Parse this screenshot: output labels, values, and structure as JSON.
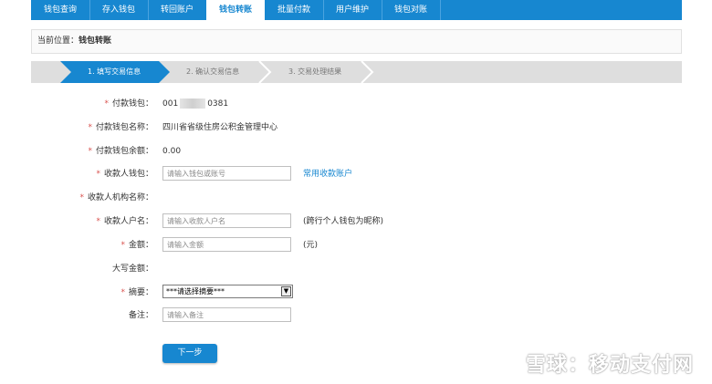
{
  "nav": {
    "tabs": [
      {
        "label": "钱包查询"
      },
      {
        "label": "存入钱包"
      },
      {
        "label": "转回账户"
      },
      {
        "label": "钱包转账"
      },
      {
        "label": "批量付款"
      },
      {
        "label": "用户维护"
      },
      {
        "label": "钱包对账"
      }
    ],
    "active_index": 3
  },
  "location": {
    "label": "当前位置：",
    "current": "钱包转账"
  },
  "steps": [
    {
      "label": "1. 填写交易信息"
    },
    {
      "label": "2. 确认交易信息"
    },
    {
      "label": "3. 交易处理结果"
    }
  ],
  "form": {
    "payer_wallet": {
      "label": "付款钱包：",
      "value_prefix": "001",
      "value_suffix": "0381"
    },
    "payer_wallet_name": {
      "label": "付款钱包名称：",
      "value": "四川省省级住房公积金管理中心"
    },
    "payer_wallet_balance": {
      "label": "付款钱包余额：",
      "value": "0.00"
    },
    "payee_wallet": {
      "label": "收款人钱包：",
      "placeholder": "请输入钱包或账号",
      "link": "常用收款账户"
    },
    "payee_org_name": {
      "label": "收款人机构名称："
    },
    "payee_account_name": {
      "label": "收款人户名：",
      "placeholder": "请输入收款人户名",
      "note": "(跨行个人钱包为昵称)"
    },
    "amount": {
      "label": "金额：",
      "placeholder": "请输入金额",
      "note": "(元)"
    },
    "amount_upper": {
      "label": "大写金额："
    },
    "summary": {
      "label": "摘要：",
      "selected": "***请选择摘要***"
    },
    "remark": {
      "label": "备注：",
      "placeholder": "请输入备注"
    }
  },
  "next_button": "下一步",
  "watermark": "雪球：移动支付网",
  "colors": {
    "accent": "#1787d0",
    "required": "#d9534f"
  }
}
